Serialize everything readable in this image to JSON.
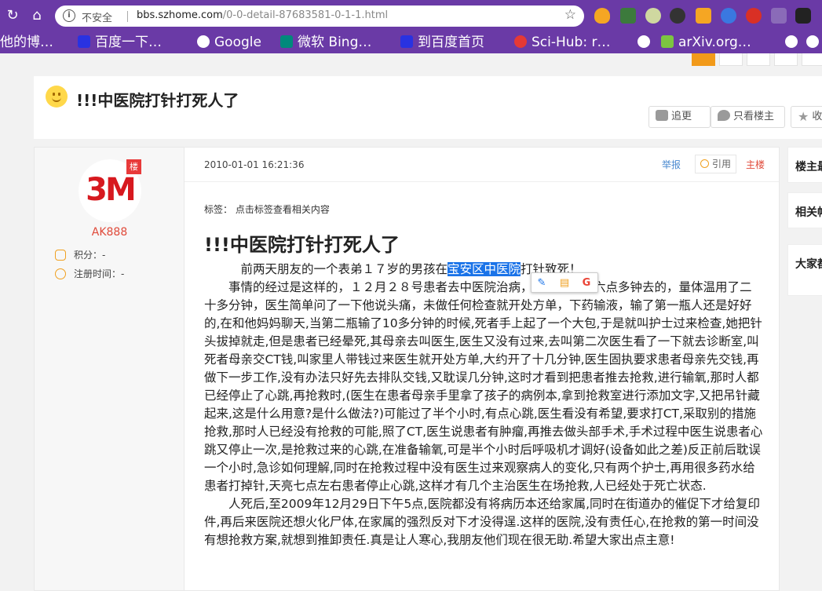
{
  "browser": {
    "insecure_label": "不安全",
    "url_host": "bbs.szhome.com",
    "url_path": "/0-0-detail-87683581-0-1-1.html",
    "bookmarks": [
      {
        "label": "他的博…",
        "icon": "none"
      },
      {
        "label": "百度一下…",
        "icon": "paw-icon"
      },
      {
        "label": "Google",
        "icon": "google-icon"
      },
      {
        "label": "微软 Bing…",
        "icon": "bing-icon"
      },
      {
        "label": "到百度首页",
        "icon": "paw-icon"
      },
      {
        "label": "Sci-Hub: r…",
        "icon": "scihub-icon"
      },
      {
        "label": "arXiv.org…",
        "icon": "arxiv-icon"
      }
    ]
  },
  "post": {
    "title": "!!!中医院打针打死人了",
    "actions": [
      {
        "label": "追更",
        "icon": "chat-icon"
      },
      {
        "label": "只看楼主",
        "icon": "drop-icon"
      },
      {
        "label": "收",
        "icon": "star-icon"
      }
    ],
    "author": {
      "name": "AK888",
      "badge": "楼",
      "avatar_text": "3M",
      "points_label": "积分：-",
      "register_label": "注册时间：-"
    },
    "date": "2010-01-01 16:21:36",
    "report_label": "举报",
    "quote_label": "引用",
    "floor_label": "主楼",
    "tags_label": "标签：  点击标签查看相关内容",
    "content_title": "!!!中医院打针打死人了",
    "para1_before": "前两天朋友的一个表弟１７岁的男孩在",
    "para1_highlight": "宝安区中医院",
    "para1_after": "打针致死！",
    "para2": "事情的经过是这样的，１２月２８号患者去中医院治病，大约是晚上六点多钟去的，量体温用了二十多分钟，医生简单问了一下他说头痛，未做任何检查就开处方单，下药输液，输了第一瓶人还是好好的,在和他妈妈聊天,当第二瓶输了10多分钟的时候,死者手上起了一个大包,于是就叫护士过来检查,她把针头拔掉就走,但是患者已经晕死,其母亲去叫医生,医生又没有过来,去叫第二次医生看了一下就去诊断室,叫死者母亲交CT钱,叫家里人带钱过来医生就开处方单,大约开了十几分钟,医生固执要求患者母亲先交钱,再做下一步工作,没有办法只好先去排队交钱,又耽误几分钟,这时才看到把患者推去抢救,进行输氧,那时人都已经停止了心跳,再抢救时,(医生在患者母亲手里拿了孩子的病例本,拿到抢救室进行添加文字,又把吊针藏起来,这是什么用意?是什么做法?)可能过了半个小时,有点心跳,医生看没有希望,要求打CT,采取别的措施抢救,那时人已经没有抢救的可能,照了CT,医生说患者有肿瘤,再推去做头部手术,手术过程中医生说患者心跳又停止一次,是抢救过来的心跳,在准备输氧,可是半个小时后呼吸机才调好(设备如此之差)反正前后耽误一个小时,急诊如何理解,同时在抢救过程中没有医生过来观察病人的变化,只有两个护士,再用很多药水给患者打掉针,天亮七点左右患者停止心跳,这样才有几个主治医生在场抢救,人已经处于死亡状态.",
    "para3": "人死后,至2009年12月29日下午5点,医院都没有将病历本还给家属,同时在街道办的催促下才给复印件,再后来医院还想火化尸体,在家属的强烈反对下才没得逞.这样的医院,没有责任心,在抢救的第一时间没有想抢救方案,就想到推卸责任.真是让人寒心,我朋友他们现在很无助.希望大家出点主意!"
  },
  "sidebar": {
    "box1": "楼主最",
    "box2": "相关帖",
    "box3": "大家都"
  },
  "colors": {
    "browser_purple": "#6a3aa6",
    "author_red": "#e04a3a",
    "link_blue": "#4a8ad0",
    "highlight_blue": "#1a73e8"
  }
}
